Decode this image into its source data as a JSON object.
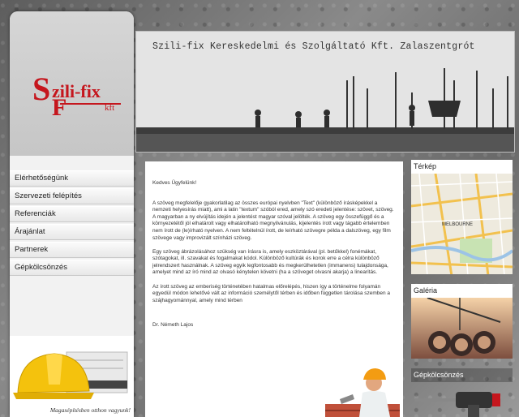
{
  "banner": {
    "title": "Szili-fix Kereskedelmi és Szolgáltató Kft. Zalaszentgrót"
  },
  "logo": {
    "s": "S",
    "name": "zili-fix",
    "f": "F",
    "kft": "kft"
  },
  "nav": {
    "items": [
      {
        "label": "Elérhetőségünk"
      },
      {
        "label": "Szervezeti felépítés"
      },
      {
        "label": "Referenciák"
      },
      {
        "label": "Árajánlat"
      },
      {
        "label": "Partnerek"
      },
      {
        "label": "Gépkölcsönzés"
      }
    ]
  },
  "slogan": "Magasépítésben otthon vagyunk!",
  "content": {
    "greeting": "Kedves Ügyfelünk!",
    "p1": "A szöveg megfelelője gyakorlatilag az összes európai nyelvben \"Text\" (különböző írásképekkel a nemzeti helyesírás miatt), ami a latin \"textum\" szóból ered, amely szó eredeti jelentése: szövet, szöveg. A magyarban a ny elvújítás idején a jelentést magyar szóval jelölték. A szöveg egy összefüggő és a környezetétől jól elhatárolt vagy elhatárolható megnyilvánulás, kijelentés írott vagy tágabb értelemben nem írott de (le)írható nyelven. A nem feltételnül írott, de leírható szövegre példa a dalszöveg, egy film szövege vagy improvizált színházi szöveg.",
    "p2": "Egy szöveg ábrázolásához szükség van írásra is, amely eszköztárával (pl. betűkkel) fonémákat, szótagokat, ill. szavakat és fogalmakat kódol. Különböző kultúrák és korok erre a célra különböző jelrendszert használnak. A szöveg egyik legfontosabb és megkerülhetetlen (immanens) tulajdonsága, amelyet mind az író mind az olvasó kénytelen követni (ha a szöveget olvasni akarja) a linearitás.",
    "p3": "Az írott szöveg az emberiség történetében hatalmas előrelépés, hiszen így a történelme folyamán egyedül módon lehetővé vált az információ személytől térben és időben független tárolása szemben a szájhagyománnyal, amely mind térben",
    "signature": "Dr. Németh Lajos"
  },
  "sidebar": {
    "map_title": "Térkép",
    "map_label": "MELBOURNE",
    "gallery_title": "Galéria",
    "rental_title": "Gépkölcsönzés"
  },
  "colors": {
    "brand_red": "#c5161d"
  }
}
